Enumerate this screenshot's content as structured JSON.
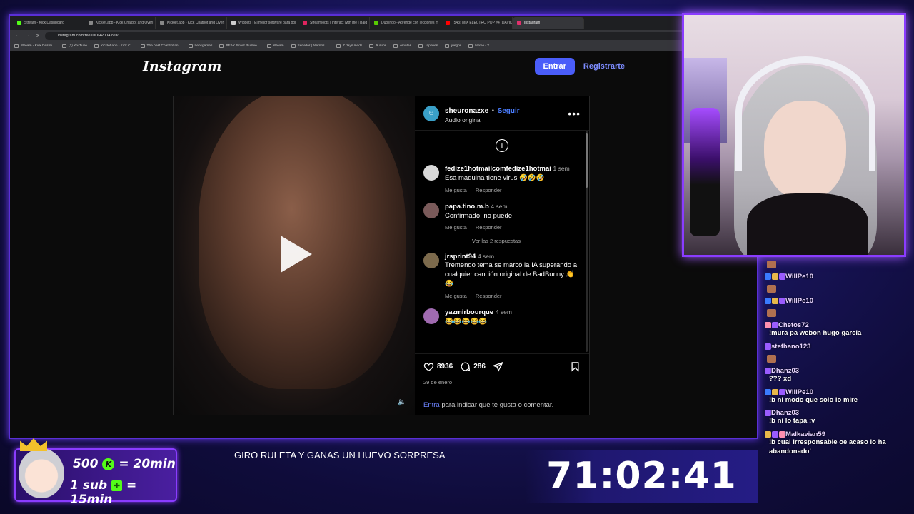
{
  "browser": {
    "tabs": [
      {
        "label": "Stream - Kick Dashboard",
        "color": "#53fc18"
      },
      {
        "label": "Kicklet.app - Kick Chatbot and Overl",
        "color": "#888888"
      },
      {
        "label": "Kicklet.app - Kick Chatbot and Overl",
        "color": "#888888"
      },
      {
        "label": "Widgets | El mejor software para por",
        "color": "#cccccc"
      },
      {
        "label": "Streamloots | Interact with me | Balq",
        "color": "#e0245e"
      },
      {
        "label": "Duolingo - Aprende con lecciones m",
        "color": "#58cc02"
      },
      {
        "label": "(543) MIX ELECTRO POP #4 (DAVID",
        "color": "#ff0000"
      },
      {
        "label": "Instagram",
        "color": "#e1306c"
      }
    ],
    "url": "instagram.com/reel/DUHPuuAkvD/",
    "bookmarks": [
      "Stream - Kick Dashb...",
      "(1) YouTube",
      "Kicklet.app - Kick C...",
      "The best ChatBot an...",
      "Leosgames",
      "PEAK Scout Plushie...",
      "stream",
      "Servidor | Aternos |...",
      "7 days mods",
      "R subs",
      "emotes",
      "Japones",
      "juegos",
      "Home / X"
    ]
  },
  "instagram": {
    "logo": "Instagram",
    "login_button": "Entrar",
    "register_link": "Registrarte",
    "post": {
      "username": "sheuronazxe",
      "follow": "Seguir",
      "audio": "Audio original",
      "likes": "8936",
      "comments_count": "286",
      "date": "29 de enero",
      "login_link": "Entra",
      "login_prompt": " para indicar que te gusta o comentar."
    },
    "comments": [
      {
        "user": "fedize1hotmailcomfedize1hotmai",
        "time": "1 sem",
        "text": "Esa maquina tiene virus 🤣🤣🤣",
        "like": "Me gusta",
        "reply": "Responder",
        "avatar_color": "#d9d9d9"
      },
      {
        "user": "papa.tino.m.b",
        "time": "4 sem",
        "text": "Confirmado: no puede",
        "like": "Me gusta",
        "reply": "Responder",
        "avatar_color": "#7a5a5a"
      },
      {
        "user": "jrsprint94",
        "time": "4 sem",
        "text": "Tremendo tema se marcó la IA superando a cualquier canción original de BadBunny 👏😂",
        "like": "Me gusta",
        "reply": "Responder",
        "avatar_color": "#7c6a4c"
      },
      {
        "user": "yazmirbourque",
        "time": "4 sem",
        "text": "😂😂😂😂😂",
        "avatar_color": "#a06ab0"
      }
    ],
    "view_replies": "Ver las 2 respuestas"
  },
  "chat": [
    {
      "user": "WillPe10",
      "message": "",
      "sticker": true,
      "badge_colors": [
        "#3a7bff",
        "#e8b84a",
        "#9a5cff"
      ]
    },
    {
      "user": "WillPe10",
      "message": "",
      "sticker": true,
      "badge_colors": [
        "#3a7bff",
        "#e8b84a",
        "#9a5cff"
      ]
    },
    {
      "user": "Chetos72",
      "message": "!mura pa webon hugo garcia",
      "sticker": false,
      "badge_colors": [
        "#ff8fb0",
        "#9a5cff"
      ]
    },
    {
      "user": "stefhano123",
      "message": "",
      "sticker": true,
      "badge_colors": [
        "#9a5cff"
      ]
    },
    {
      "user": "Dhanz03",
      "message": "??? xd",
      "sticker": false,
      "badge_colors": [
        "#9a5cff"
      ]
    },
    {
      "user": "WillPe10",
      "message": "!b ni modo que solo lo mire",
      "sticker": false,
      "badge_colors": [
        "#3a7bff",
        "#e8b84a",
        "#9a5cff"
      ]
    },
    {
      "user": "Dhanz03",
      "message": "!b ni lo tapa :v",
      "sticker": false,
      "badge_colors": [
        "#9a5cff"
      ]
    },
    {
      "user": "Malkavian59",
      "message": "!b cual irresponsable oe acaso lo ha abandonado'",
      "sticker": false,
      "badge_colors": [
        "#e8b84a",
        "#9a5cff",
        "#ff8fb0"
      ]
    }
  ],
  "overlay": {
    "promo_line1_amount": "500",
    "promo_line1_rest": "= 20min",
    "promo_line2_amount": "1 sub",
    "promo_line2_rest": "= 15min",
    "kick_symbol": "K",
    "gift_symbol": "✚",
    "ticker": "GIRO RULETA Y GANAS UN HUEVO SORPRESA",
    "timer": "71:02:41"
  }
}
